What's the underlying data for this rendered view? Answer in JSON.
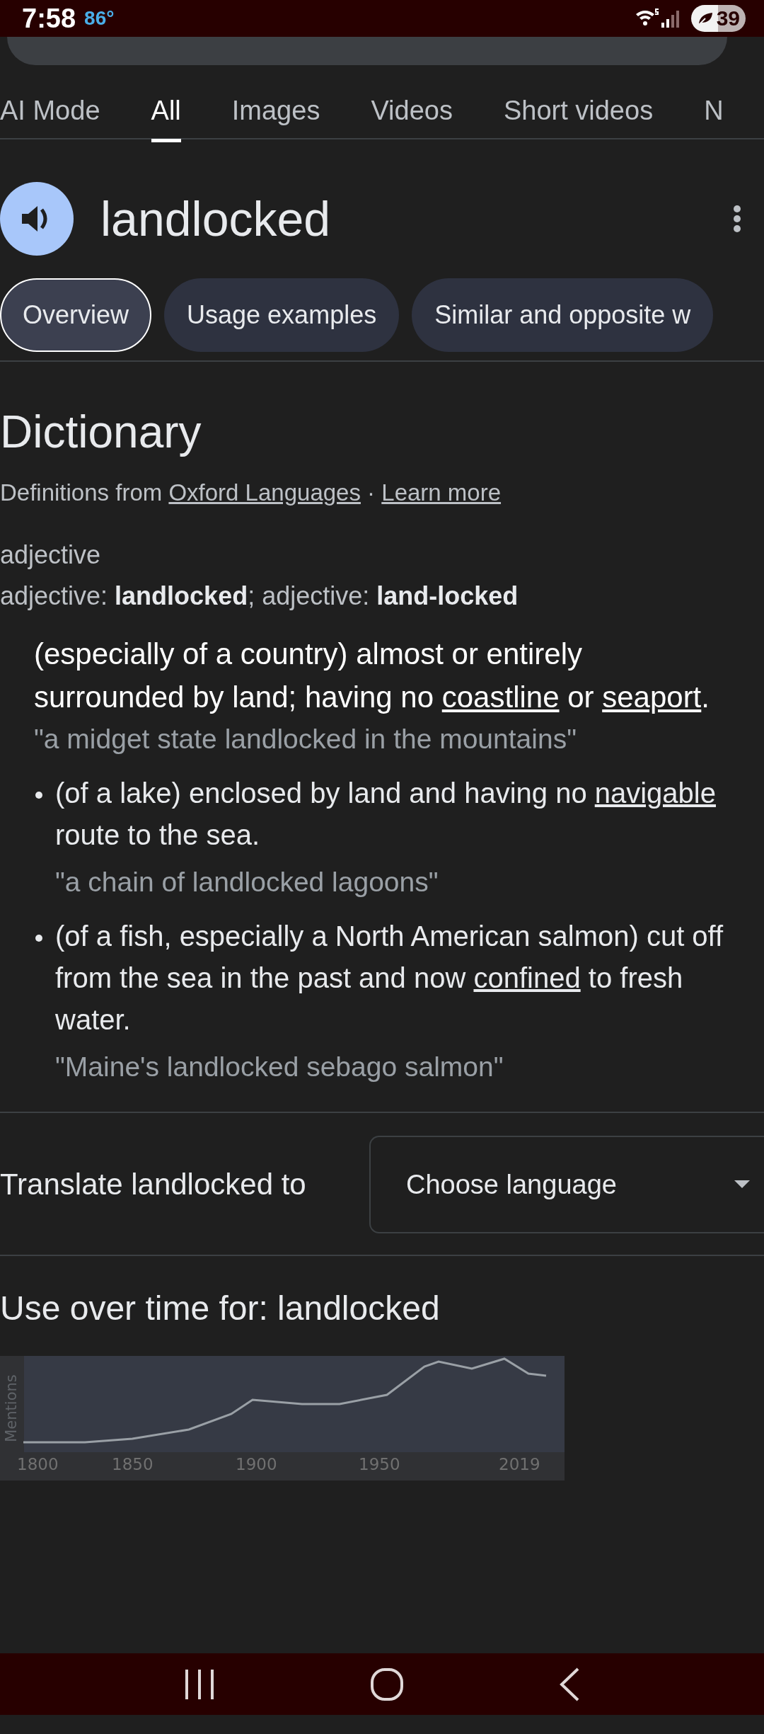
{
  "status_bar": {
    "time": "7:58",
    "temperature": "86°",
    "battery": "39"
  },
  "search_tabs": [
    {
      "label": "AI Mode",
      "selected": false
    },
    {
      "label": "All",
      "selected": true
    },
    {
      "label": "Images",
      "selected": false
    },
    {
      "label": "Videos",
      "selected": false
    },
    {
      "label": "Short videos",
      "selected": false
    },
    {
      "label": "N",
      "selected": false
    }
  ],
  "word": "landlocked",
  "chips": [
    {
      "label": "Overview",
      "selected": true
    },
    {
      "label": "Usage examples",
      "selected": false
    },
    {
      "label": "Similar and opposite w",
      "selected": false
    }
  ],
  "dictionary": {
    "title": "Dictionary",
    "source": [
      {
        "text": "Definitions from ",
        "link": false
      },
      {
        "text": "Oxford Languages",
        "link": true
      },
      {
        "text": " · ",
        "link": false
      },
      {
        "text": "Learn more",
        "link": true
      }
    ],
    "part_of_speech": "adjective",
    "forms": "adjective: **landlocked**; adjective: **land-locked**",
    "definition": [
      {
        "text": "(especially of a country) almost or entirely surrounded by land; having no ",
        "link": false
      },
      {
        "text": "coastline",
        "link": true
      },
      {
        "text": " or ",
        "link": false
      },
      {
        "text": "seaport",
        "link": true
      },
      {
        "text": ".",
        "link": false
      }
    ],
    "example": "\"a midget state landlocked in the mountains\"",
    "subsenses": [
      {
        "definition": [
          {
            "text": "(of a lake) enclosed by land and having no ",
            "link": false
          },
          {
            "text": "navigable",
            "link": true
          },
          {
            "text": " route to the sea.",
            "link": false
          }
        ],
        "example": "\"a chain of landlocked lagoons\""
      },
      {
        "definition": [
          {
            "text": "(of a fish, especially a North American salmon) cut off from the sea in the past and now ",
            "link": false
          },
          {
            "text": "confined",
            "link": true
          },
          {
            "text": " to fresh water.",
            "link": false
          }
        ],
        "example": "\"Maine's landlocked sebago salmon\""
      }
    ]
  },
  "translate": {
    "label": "Translate landlocked to",
    "language": "Choose language"
  },
  "usage": {
    "title": "Use over time for: landlocked",
    "ylabel": "Mentions",
    "x_labels": [
      "1800",
      "1850",
      "1900",
      "1950",
      "2019"
    ]
  }
}
